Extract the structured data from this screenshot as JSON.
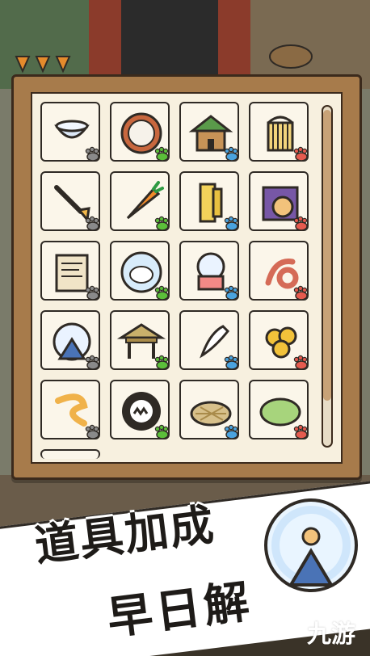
{
  "promo": {
    "line1": "道具加成",
    "line2": "早日解"
  },
  "watermark": "九游",
  "inventory": {
    "items": [
      {
        "icon": "bowl-icon",
        "label": "bowl"
      },
      {
        "icon": "round-cushion-icon",
        "label": "round cushion"
      },
      {
        "icon": "cat-house-icon",
        "label": "cat house"
      },
      {
        "icon": "bird-cage-icon",
        "label": "bird cage"
      },
      {
        "icon": "shovel-icon",
        "label": "shovel"
      },
      {
        "icon": "carrot-icon",
        "label": "carrot"
      },
      {
        "icon": "wood-plank-icon",
        "label": "wood plank"
      },
      {
        "icon": "cat-bag-icon",
        "label": "cat bag"
      },
      {
        "icon": "paper-scroll-icon",
        "label": "paper scroll"
      },
      {
        "icon": "sheep-bubble-icon",
        "label": "sheep bubble"
      },
      {
        "icon": "gachapon-icon",
        "label": "gachapon"
      },
      {
        "icon": "rope-icon",
        "label": "rope"
      },
      {
        "icon": "hamster-wheel-icon",
        "label": "hamster wheel"
      },
      {
        "icon": "straw-hut-icon",
        "label": "straw hut"
      },
      {
        "icon": "tooth-icon",
        "label": "tooth"
      },
      {
        "icon": "golden-nuggets-icon",
        "label": "golden nuggets"
      },
      {
        "icon": "worm-icon",
        "label": "worm"
      },
      {
        "icon": "ghost-ball-icon",
        "label": "ghost ball"
      },
      {
        "icon": "straw-nest-icon",
        "label": "straw nest"
      },
      {
        "icon": "green-bush-icon",
        "label": "green bush"
      }
    ],
    "partial_row_visible": true
  },
  "colors": {
    "frame_wood": "#a77b4b",
    "panel_bg": "#f7f0df",
    "outline": "#2f2a25",
    "paw_grey": "#8a8a8a",
    "paw_green": "#5bbf3a",
    "paw_blue": "#4aa3df",
    "paw_red": "#e55b4f"
  },
  "badge": {
    "icon": "hamster-wheel-icon"
  }
}
